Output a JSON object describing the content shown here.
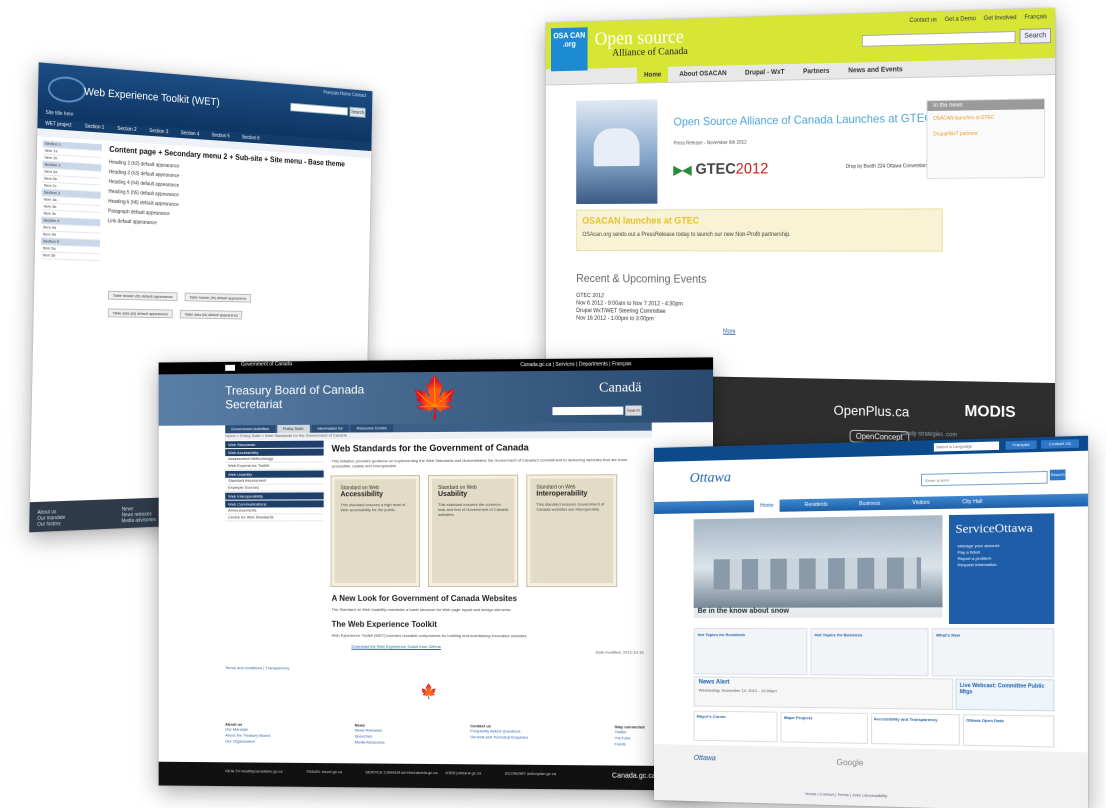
{
  "wet": {
    "toplinks": "Français   Home   Contact",
    "title": "Web Experience Toolkit (WET)",
    "search_btn": "Search",
    "site_name": "Site title here",
    "menu": [
      "WET project",
      "Section 1",
      "Section 2",
      "Section 3",
      "Section 4",
      "Section 5",
      "Section 6"
    ],
    "sidebar": [
      "Section 1",
      "Item 1a",
      "Item 1b",
      "Section 2",
      "Item 2a",
      "Item 2b",
      "Item 2c",
      "Section 3",
      "Item 3a",
      "Item 3b",
      "Item 3c",
      "Section 4",
      "Item 4a",
      "Item 4b",
      "Section 5",
      "Item 5a",
      "Item 5b"
    ],
    "page_title": "Content page + Secondary menu 2 + Sub-site + Site menu - Base theme",
    "headings": [
      "Heading 2 (h2) default appearance",
      "Heading 3 (h3) default appearance",
      "Heading 4 (h4) default appearance",
      "Heading 5 (h5) default appearance",
      "Heading 6 (h6) default appearance",
      "Paragraph default appearance",
      "Link default appearance"
    ],
    "buttons": [
      "Table header (th) default appearance",
      "Table header (th) default appearance",
      "Table data (td) default appearance",
      "Table data (td) default appearance"
    ],
    "footer_cols": [
      "About us",
      "News"
    ],
    "footer_items": [
      "Our mandate",
      "Our history",
      "News releases",
      "Media advisories"
    ]
  },
  "osacan": {
    "badge": "OSA CAN .org",
    "brand_top": "Open source",
    "brand_bottom": "Alliance of Canada",
    "toplinks": [
      "Contact us",
      "Get a Demo",
      "Get Involved",
      "Français"
    ],
    "search_btn": "Search",
    "nav": [
      "Home",
      "About OSACAN",
      "Drupal - WxT",
      "Partners",
      "News and Events"
    ],
    "hero_title": "Open Source Alliance of Canada Launches at GTEC 2012",
    "hero_meta": "Press Release - November 6th 2012",
    "gtec": "GTEC",
    "gtec_year": "2012",
    "booth": "Drop by Booth 224 Ottawa Convention Centre",
    "sidebox_header": "In the news",
    "sidebox_links": [
      "OSACAN launches at GTEC",
      "Drupal/WxT partners"
    ],
    "launch_title": "OSACAN launches at GTEC",
    "launch_desc": "OSAcan.org sends out a PressRelease today to launch our new Non-Profit partnership.",
    "events_title": "Recent & Upcoming Events",
    "events": [
      "GTEC 2012",
      "Nov 6 2012 - 9:00am to Nov 7 2012 - 4:30pm",
      "Drupal WxT/WET Steering Committee",
      "Nov 16 2012 - 1:00pm to 3:00pm"
    ],
    "more": "More",
    "partners": {
      "openplus": "OpenPlus.ca",
      "modis": "MODIS",
      "openconcept": "OpenConcept",
      "candy": "candy strategies .com"
    }
  },
  "tbs": {
    "dept": "Government of Canada",
    "fip_right": "Canada.gc.ca  |  Services  |  Departments  |  Français",
    "title_line1": "Treasury Board of Canada",
    "title_line2": "Secretariat",
    "wordmark": "Canadä",
    "search_btn": "Search",
    "nav": [
      "Government Activities",
      "Policy Suite",
      "Information for",
      "Resource Centre"
    ],
    "crumb": "Home > Policy Suite > Web Standards for the Government of Canada",
    "left_headers": [
      "Web Standards",
      "Web Accessibility",
      "Web Usability",
      "Web Interoperability",
      "Web Communications"
    ],
    "left_items": [
      "Assessment Methodology",
      "Web Experience Toolkit",
      "Standard Assessment",
      "Example Sources",
      "Announcements",
      "Centre for Web Standards"
    ],
    "h1": "Web Standards for the Government of Canada",
    "intro": "This initiative provides guidance on implementing the Web Standards and demonstrates the Government of Canada's commitment to delivering websites that are more accessible, usable and interoperable.",
    "tiles": [
      {
        "kicker": "Standard on Web",
        "name": "Accessibility",
        "desc": "This standard ensures a high level of Web accessibility for the public."
      },
      {
        "kicker": "Standard on Web",
        "name": "Usability",
        "desc": "This standard ensures the common look and feel of Government of Canada websites."
      },
      {
        "kicker": "Standard on Web",
        "name": "Interoperability",
        "desc": "This standard ensures Government of Canada websites are interoperable."
      }
    ],
    "h2a": "A New Look for Government of Canada Websites",
    "pa": "The Standard on Web Usability mandates a basic structure for Web page layout and design elements.",
    "h2b": "The Web Experience Toolkit",
    "pb": "Web Experience Toolkit (WET) includes reusable components for building and maintaining innovative websites.",
    "bullet": "Download the Web Experience Toolkit from GitHub",
    "modified": "Date modified: 2012-10-15",
    "foot_links": "Terms and conditions  |  Transparency",
    "foot_cols": [
      {
        "h": "About us",
        "items": [
          "Our Mandate",
          "About the Treasury Board",
          "Our Organization"
        ]
      },
      {
        "h": "News",
        "items": [
          "News Releases",
          "Speeches",
          "Media Advisories"
        ]
      },
      {
        "h": "Contact us",
        "items": [
          "Frequently Asked Questions",
          "General and Technical Enquiries"
        ]
      },
      {
        "h": "Stay connected",
        "items": [
          "Twitter",
          "YouTube",
          "Feeds"
        ]
      }
    ],
    "fbar": [
      "HEALTH healthycanadians.gc.ca",
      "TRAVEL travel.gc.ca",
      "SERVICE CANADA servicecanada.gc.ca",
      "JOBS jobbank.gc.ca",
      "ECONOMY actionplan.gc.ca"
    ],
    "canada_gc": "Canada.gc.ca"
  },
  "ottawa": {
    "select": "Select a Language",
    "b1": "Français",
    "b2": "Contact Us",
    "logo": "Ottawa",
    "search_ph": "Enter a term",
    "search_btn": "Search",
    "nav": [
      "Home",
      "Residents",
      "Business",
      "Visitors",
      "City Hall"
    ],
    "hero_caption": "Be in the know about snow",
    "so_title": "ServiceOttawa",
    "so_items": [
      "Manage your account",
      "Pay a ticket",
      "Report a problem",
      "Request information"
    ],
    "cols": [
      "Hot Topics for Residents",
      "Hot Topics for Business",
      "What's New"
    ],
    "news_title": "News Alert",
    "news_date": "Wednesday, November 14, 2012 - 10:00am",
    "llw_title": "Live Webcast: Committee Public Mtgs",
    "tiles": [
      "Mayor's Corner",
      "Major Projects",
      "Accessibility and Transparency",
      "Ottawa Open Data"
    ],
    "foot_logo": "Ottawa",
    "google": "Google",
    "foot_links": "Home  |  Contact  |  Terms  |  Jobs  |  Accessibility"
  }
}
